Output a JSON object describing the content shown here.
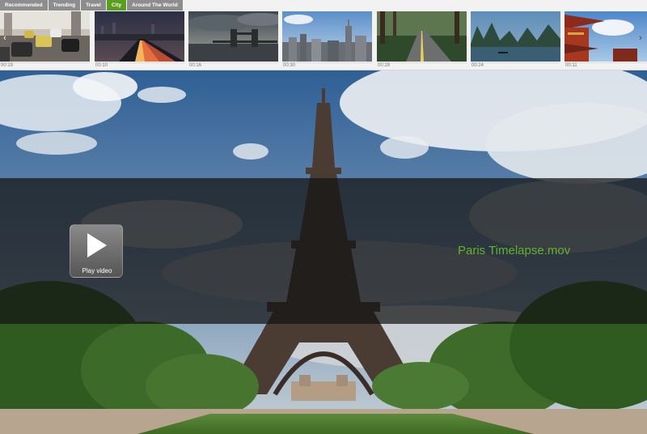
{
  "tabs": [
    {
      "label": "Recommended",
      "active": false
    },
    {
      "label": "Trending",
      "active": false
    },
    {
      "label": "Travel",
      "active": false
    },
    {
      "label": "City",
      "active": true
    },
    {
      "label": "Around The World",
      "active": false
    }
  ],
  "thumbnails": [
    {
      "duration": "00:19",
      "scene": "traffic"
    },
    {
      "duration": "00:10",
      "scene": "bridge-night"
    },
    {
      "duration": "00:16",
      "scene": "tower-bridge"
    },
    {
      "duration": "00:30",
      "scene": "skyline"
    },
    {
      "duration": "00:29",
      "scene": "road-forest"
    },
    {
      "duration": "00:24",
      "scene": "karst-river"
    },
    {
      "duration": "00:11",
      "scene": "pagoda"
    }
  ],
  "hero": {
    "video_title": "Paris Timelapse.mov",
    "play_label": "Play video"
  },
  "colors": {
    "accent": "#5a9e1e",
    "title": "#63b32e",
    "tab": "#8d8d8d"
  }
}
